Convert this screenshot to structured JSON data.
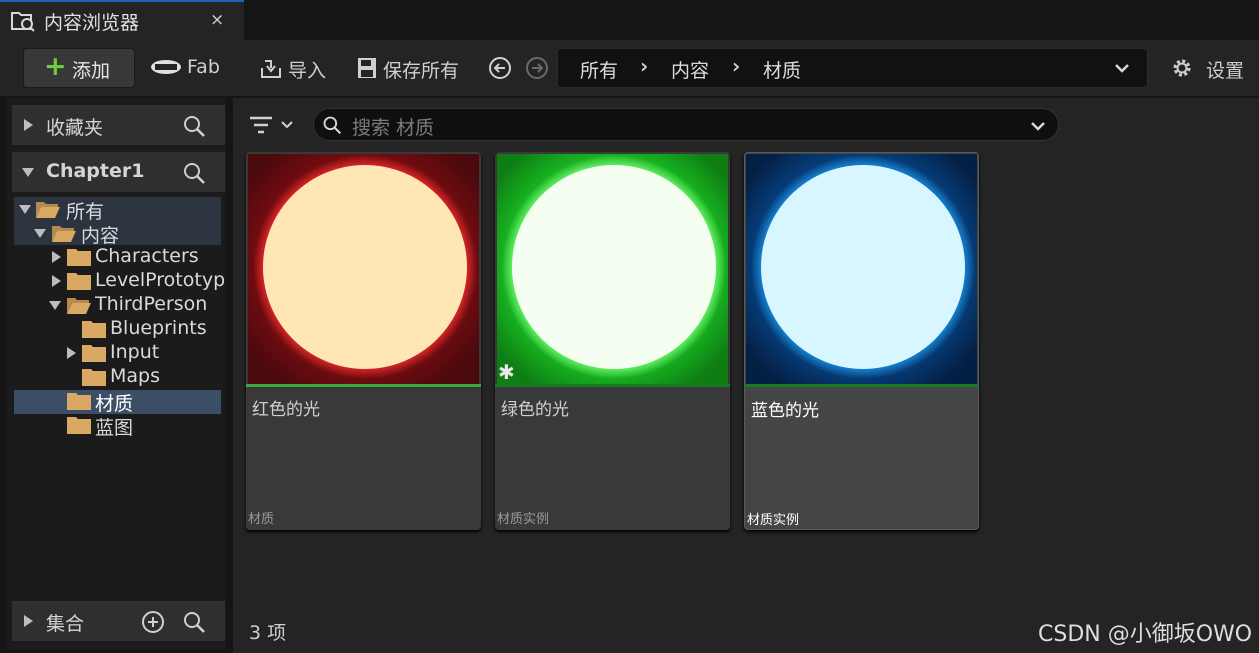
{
  "tab": {
    "title": "内容浏览器",
    "close": "×",
    "icon": "folder-search-icon"
  },
  "toolbar": {
    "add_label": "添加",
    "fab_label": "Fab",
    "import_label": "导入",
    "save_all_label": "保存所有",
    "settings_label": "设置",
    "breadcrumb": [
      "所有",
      "内容",
      "材质"
    ]
  },
  "left": {
    "favorites_title": "收藏夹",
    "project_title": "Chapter1",
    "tree": [
      {
        "label": "所有",
        "expanded": true
      },
      {
        "label": "内容",
        "expanded": true
      },
      {
        "label": "Characters",
        "expanded": false
      },
      {
        "label": "LevelPrototypi",
        "expanded": false
      },
      {
        "label": "ThirdPerson",
        "expanded": true
      },
      {
        "label": "Blueprints"
      },
      {
        "label": "Input",
        "expanded": false
      },
      {
        "label": "Maps"
      },
      {
        "label": "材质",
        "selected": true
      },
      {
        "label": "蓝图"
      }
    ],
    "collections_title": "集合"
  },
  "search": {
    "placeholder": "搜索 材质"
  },
  "assets": [
    {
      "name": "红色的光",
      "type": "材质",
      "color": "#e02020"
    },
    {
      "name": "绿色的光",
      "type": "材质实例",
      "color": "#22c932"
    },
    {
      "name": "蓝色的光",
      "type": "材质实例",
      "color": "#1a8fe0"
    }
  ],
  "status": {
    "count": "3 项"
  },
  "watermark": "CSDN @小御坂OWO",
  "colors": {
    "accent_add": "#6fcb3f",
    "selection": "#3c4e66",
    "tab_border": "#1a62c4"
  }
}
